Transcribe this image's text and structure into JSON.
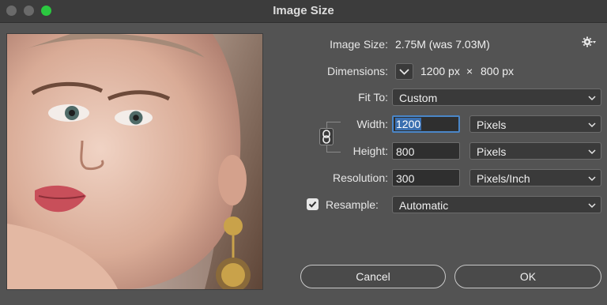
{
  "window": {
    "title": "Image Size"
  },
  "image_size": {
    "label": "Image Size:",
    "value": "2.75M (was 7.03M)"
  },
  "dimensions": {
    "label": "Dimensions:",
    "width": "1200 px",
    "times": "×",
    "height": "800 px"
  },
  "fit_to": {
    "label": "Fit To:",
    "value": "Custom"
  },
  "width": {
    "label": "Width:",
    "value": "1200",
    "unit": "Pixels"
  },
  "height": {
    "label": "Height:",
    "value": "800",
    "unit": "Pixels"
  },
  "resolution": {
    "label": "Resolution:",
    "value": "300",
    "unit": "Pixels/Inch"
  },
  "resample": {
    "label": "Resample:",
    "value": "Automatic",
    "checked": true
  },
  "buttons": {
    "cancel": "Cancel",
    "ok": "OK"
  },
  "icons": {
    "settings": "gear-icon",
    "link": "chain-link-icon",
    "chevron": "chevron-down-icon"
  }
}
